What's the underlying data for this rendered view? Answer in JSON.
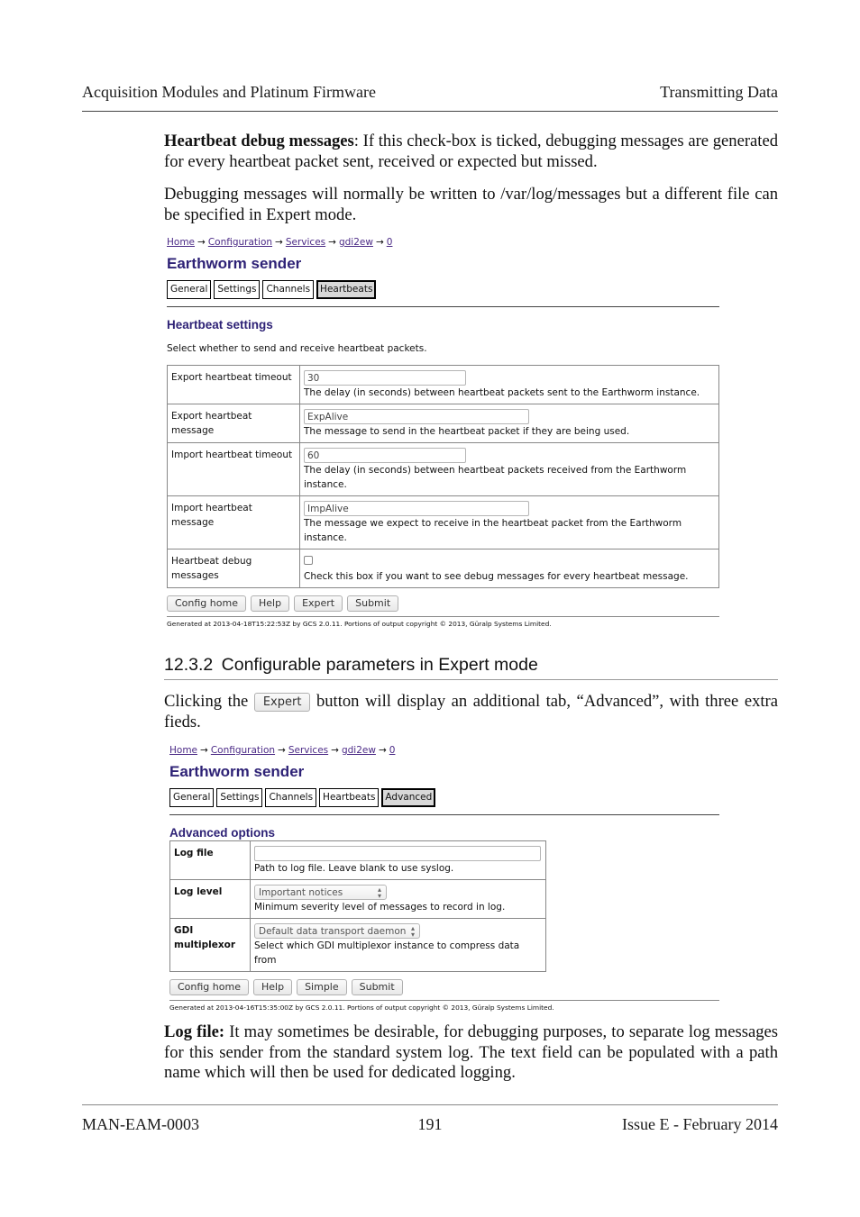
{
  "header": {
    "left": "Acquisition Modules and Platinum Firmware",
    "right": "Transmitting Data"
  },
  "intro": {
    "p1_bold": "Heartbeat debug messages",
    "p1_rest": ":  If this check-box is ticked, debugging messages are generated for every heartbeat packet sent, received or expected but missed.",
    "p2": "Debugging messages will normally be written to /var/log/messages but a different file can be specified in Expert mode."
  },
  "screenshot1": {
    "breadcrumb": [
      "Home",
      "Configuration",
      "Services",
      "gdi2ew",
      "0"
    ],
    "arrow": "→",
    "title": "Earthworm sender",
    "tabs": [
      {
        "label": "General",
        "active": false
      },
      {
        "label": "Settings",
        "active": false
      },
      {
        "label": "Channels",
        "active": false
      },
      {
        "label": "Heartbeats",
        "active": true
      }
    ],
    "section_title": "Heartbeat settings",
    "section_desc": "Select whether to send and receive heartbeat packets.",
    "rows": [
      {
        "label": "Export heartbeat timeout",
        "value": "30",
        "help": "The delay (in seconds) between heartbeat packets sent to the Earthworm instance."
      },
      {
        "label": "Export heartbeat message",
        "value": "ExpAlive",
        "help": "The message to send in the heartbeat packet if they are being used."
      },
      {
        "label": "Import heartbeat timeout",
        "value": "60",
        "help": "The delay (in seconds) between heartbeat packets received from the Earthworm instance."
      },
      {
        "label": "Import heartbeat message",
        "value": "ImpAlive",
        "help": "The message we expect to receive in the heartbeat packet from the Earthworm instance."
      },
      {
        "label": "Heartbeat debug messages",
        "checked": false,
        "help": "Check this box if you want to see debug messages for every heartbeat message."
      }
    ],
    "buttons": [
      "Config home",
      "Help",
      "Expert",
      "Submit"
    ],
    "generated": "Generated at 2013-04-18T15:22:53Z by GCS 2.0.11. Portions of output copyright © 2013, Güralp Systems Limited."
  },
  "section_heading": {
    "number": "12.3.2",
    "title": "Configurable parameters in Expert mode"
  },
  "expert_para": {
    "before": "Clicking the",
    "button": "Expert",
    "after": "button will display an additional tab, “Advanced”, with three extra fieds."
  },
  "screenshot2": {
    "breadcrumb": [
      "Home",
      "Configuration",
      "Services",
      "gdi2ew",
      "0"
    ],
    "arrow": "→",
    "title": "Earthworm sender",
    "tabs": [
      {
        "label": "General",
        "active": false
      },
      {
        "label": "Settings",
        "active": false
      },
      {
        "label": "Channels",
        "active": false
      },
      {
        "label": "Heartbeats",
        "active": false
      },
      {
        "label": "Advanced",
        "active": true
      }
    ],
    "section_title": "Advanced options",
    "rows": [
      {
        "label": "Log file",
        "value": "",
        "help": "Path to log file. Leave blank to use syslog."
      },
      {
        "label": "Log level",
        "selected": "Important notices",
        "help": "Minimum severity level of messages to record in log."
      },
      {
        "label": "GDI multiplexor",
        "selected": "Default data transport daemon",
        "help": "Select which GDI multiplexor instance to compress data from"
      }
    ],
    "buttons": [
      "Config home",
      "Help",
      "Simple",
      "Submit"
    ],
    "generated": "Generated at 2013-04-16T15:35:00Z by GCS 2.0.11. Portions of output copyright © 2013, Güralp Systems Limited."
  },
  "logfile_para": {
    "bold": "Log file:",
    "rest": "  It may sometimes be desirable, for debugging purposes, to separate log messages for this sender from the standard system log.  The text field can be populated with a path name which will then be used for dedicated logging."
  },
  "footer": {
    "left": "MAN-EAM-0003",
    "center": "191",
    "right": "Issue E  - February 2014"
  }
}
